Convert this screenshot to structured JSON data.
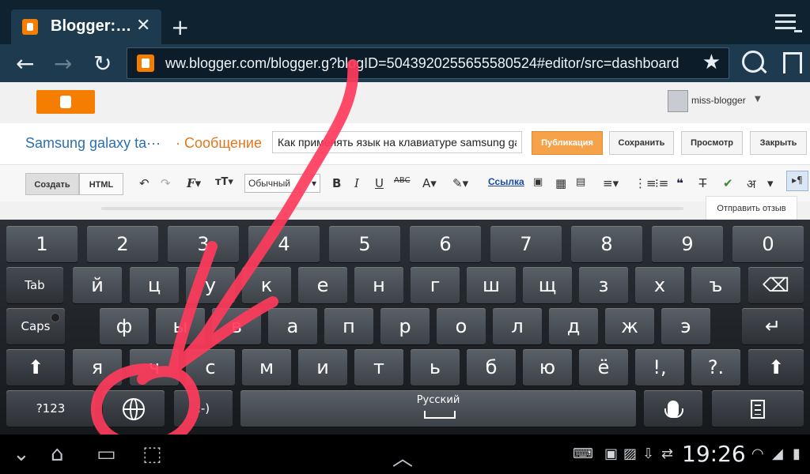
{
  "browser": {
    "tab_title": "Blogger:…",
    "tab_close": "✕",
    "new_tab": "+",
    "url": "ww.blogger.com/blogger.g?blogID=5043920255655580524#editor/src=dashboard",
    "icons": [
      "back-icon",
      "forward-icon",
      "reload-icon",
      "star-icon",
      "search-icon",
      "bookmark-icon",
      "menu-icon"
    ]
  },
  "blogger": {
    "username": "miss-blogger",
    "blog_title": "Samsung galaxy ta···",
    "post_label": "· Сообщение",
    "post_title": "Как применять язык на клавиатуре samsung gala",
    "buttons": {
      "publish": "Публикация",
      "save": "Сохранить",
      "preview": "Просмотр",
      "close": "Закрыть"
    },
    "toolbar": {
      "create": "Создать",
      "html": "HTML",
      "format": "Обычный",
      "link": "Ссылка",
      "feedback": "Отправить отзыв"
    }
  },
  "keyboard": {
    "language": "Русский",
    "row1": [
      "1",
      "2",
      "3",
      "4",
      "5",
      "6",
      "7",
      "8",
      "9",
      "0"
    ],
    "row2_tab": "Tab",
    "row2": [
      "й",
      "ц",
      "у",
      "к",
      "е",
      "н",
      "г",
      "ш",
      "щ",
      "з",
      "х",
      "ъ"
    ],
    "row3_caps": "Caps",
    "row3": [
      "ф",
      "ы",
      "в",
      "а",
      "п",
      "р",
      "о",
      "л",
      "д",
      "ж",
      "э"
    ],
    "row4": [
      "я",
      "ч",
      "с",
      "м",
      "и",
      "т",
      "ь",
      "б",
      "ю",
      "ё",
      "!,",
      "?."
    ],
    "sym_key": "?123",
    "smiley_key": ":-)"
  },
  "system": {
    "time": "19:26"
  },
  "colors": {
    "annotation": "#ff3b5c",
    "blogger_orange": "#f57d00",
    "title_blue": "#2a6fb2",
    "post_orange": "#e0761c"
  }
}
